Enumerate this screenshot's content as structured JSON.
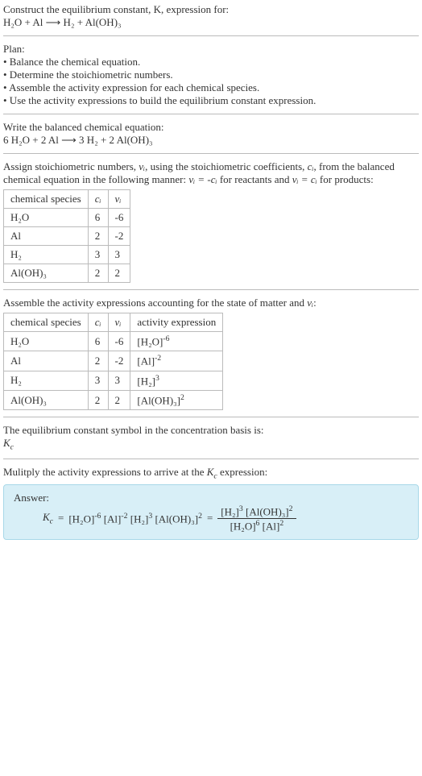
{
  "intro": {
    "line1": "Construct the equilibrium constant, K, expression for:",
    "equation": "H₂O + Al ⟶ H₂ + Al(OH)₃"
  },
  "plan": {
    "heading": "Plan:",
    "bullet1": "• Balance the chemical equation.",
    "bullet2": "• Determine the stoichiometric numbers.",
    "bullet3": "• Assemble the activity expression for each chemical species.",
    "bullet4": "• Use the activity expressions to build the equilibrium constant expression."
  },
  "balanced": {
    "heading": "Write the balanced chemical equation:",
    "equation": "6 H₂O + 2 Al ⟶ 3 H₂ + 2 Al(OH)₃"
  },
  "stoich": {
    "heading_pre": "Assign stoichiometric numbers, ",
    "heading_nu": "νᵢ",
    "heading_mid1": ", using the stoichiometric coefficients, ",
    "heading_ci": "cᵢ",
    "heading_mid2": ", from the balanced chemical equation in the following manner: ",
    "rel_react": "νᵢ = -cᵢ",
    "heading_react": " for reactants and ",
    "rel_prod": "νᵢ = cᵢ",
    "heading_prod": " for products:",
    "table": {
      "h1": "chemical species",
      "h2": "cᵢ",
      "h3": "νᵢ",
      "rows": [
        {
          "species": "H₂O",
          "ci": "6",
          "nu": "-6"
        },
        {
          "species": "Al",
          "ci": "2",
          "nu": "-2"
        },
        {
          "species": "H₂",
          "ci": "3",
          "nu": "3"
        },
        {
          "species": "Al(OH)₃",
          "ci": "2",
          "nu": "2"
        }
      ]
    }
  },
  "activity": {
    "heading_pre": "Assemble the activity expressions accounting for the state of matter and ",
    "heading_nu": "νᵢ",
    "heading_post": ":",
    "table": {
      "h1": "chemical species",
      "h2": "cᵢ",
      "h3": "νᵢ",
      "h4": "activity expression",
      "rows": [
        {
          "species": "H₂O",
          "ci": "6",
          "nu": "-6",
          "expr_base": "[H₂O]",
          "expr_exp": "-6"
        },
        {
          "species": "Al",
          "ci": "2",
          "nu": "-2",
          "expr_base": "[Al]",
          "expr_exp": "-2"
        },
        {
          "species": "H₂",
          "ci": "3",
          "nu": "3",
          "expr_base": "[H₂]",
          "expr_exp": "3"
        },
        {
          "species": "Al(OH)₃",
          "ci": "2",
          "nu": "2",
          "expr_base": "[Al(OH)₃]",
          "expr_exp": "2"
        }
      ]
    }
  },
  "symbol": {
    "heading": "The equilibrium constant symbol in the concentration basis is:",
    "symbol_base": "K",
    "symbol_sub": "c"
  },
  "multiply": {
    "heading_pre": "Mulitply the activity expressions to arrive at the ",
    "k_base": "K",
    "k_sub": "c",
    "heading_post": " expression:"
  },
  "answer": {
    "label": "Answer:",
    "lhs_k": "K",
    "lhs_k_sub": "c",
    "eq": " = ",
    "term1_base": "[H₂O]",
    "term1_exp": "-6",
    "term2_base": "[Al]",
    "term2_exp": "-2",
    "term3_base": "[H₂]",
    "term3_exp": "3",
    "term4_base": "[Al(OH)₃]",
    "term4_exp": "2",
    "frac_num_t1_base": "[H₂]",
    "frac_num_t1_exp": "3",
    "frac_num_t2_base": "[Al(OH)₃]",
    "frac_num_t2_exp": "2",
    "frac_den_t1_base": "[H₂O]",
    "frac_den_t1_exp": "6",
    "frac_den_t2_base": "[Al]",
    "frac_den_t2_exp": "2"
  }
}
